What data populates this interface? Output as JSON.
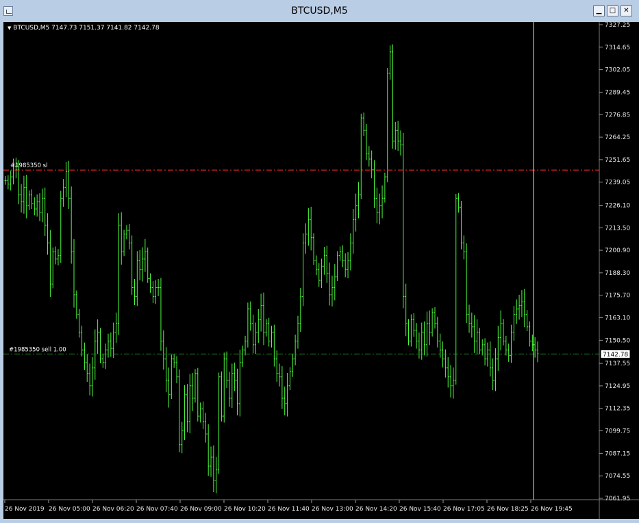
{
  "window": {
    "title": "BTCUSD,M5",
    "controls": [
      "minimize",
      "maximize",
      "close"
    ]
  },
  "chart": {
    "legend_symbol": "BTCUSD,M5",
    "legend_ohlc": "7147.73 7151.37 7141.82 7142.78",
    "current_price": "7142.78",
    "order_lines": [
      {
        "label": "#1985350 sl",
        "price": 7245.8,
        "color": "#ff2a2a"
      },
      {
        "label": "#1985350 sell 1.00",
        "price": 7142.78,
        "color": "#21a121"
      }
    ],
    "crosshair_time": "26 Nov 19:45"
  },
  "chart_data": {
    "type": "candlestick",
    "symbol": "BTCUSD",
    "timeframe": "M5",
    "ylim": [
      7055,
      7330
    ],
    "y_ticks": [
      "7327.25",
      "7314.65",
      "7302.05",
      "7289.45",
      "7276.85",
      "7264.25",
      "7251.65",
      "7239.05",
      "7226.10",
      "7213.50",
      "7200.90",
      "7188.30",
      "7175.70",
      "7163.10",
      "7150.50",
      "7137.55",
      "7124.95",
      "7112.35",
      "7099.75",
      "7087.15",
      "7074.55",
      "7061.95"
    ],
    "x_ticks": [
      "26 Nov 2019",
      "26 Nov 05:00",
      "26 Nov 06:20",
      "26 Nov 07:40",
      "26 Nov 09:00",
      "26 Nov 10:20",
      "26 Nov 11:40",
      "26 Nov 13:00",
      "26 Nov 14:20",
      "26 Nov 15:40",
      "26 Nov 17:05",
      "26 Nov 18:25",
      "26 Nov 19:45"
    ],
    "close_path": [
      7240,
      7238,
      7242,
      7248,
      7246,
      7232,
      7228,
      7236,
      7226,
      7232,
      7227,
      7224,
      7228,
      7222,
      7230,
      7215,
      7205,
      7182,
      7200,
      7196,
      7198,
      7230,
      7236,
      7245,
      7230,
      7200,
      7176,
      7165,
      7155,
      7145,
      7138,
      7132,
      7125,
      7135,
      7150,
      7155,
      7140,
      7138,
      7145,
      7150,
      7146,
      7155,
      7160,
      7215,
      7200,
      7210,
      7212,
      7205,
      7180,
      7175,
      7195,
      7190,
      7196,
      7200,
      7185,
      7180,
      7175,
      7180,
      7180,
      7150,
      7140,
      7128,
      7120,
      7140,
      7138,
      7130,
      7092,
      7100,
      7120,
      7105,
      7125,
      7118,
      7132,
      7108,
      7112,
      7105,
      7098,
      7080,
      7085,
      7072,
      7078,
      7130,
      7108,
      7140,
      7128,
      7118,
      7132,
      7128,
      7115,
      7138,
      7145,
      7150,
      7168,
      7160,
      7148,
      7155,
      7162,
      7170,
      7155,
      7160,
      7150,
      7155,
      7140,
      7132,
      7130,
      7118,
      7115,
      7125,
      7133,
      7140,
      7150,
      7160,
      7175,
      7205,
      7210,
      7218,
      7208,
      7195,
      7190,
      7184,
      7192,
      7198,
      7188,
      7176,
      7180,
      7186,
      7198,
      7200,
      7195,
      7190,
      7195,
      7205,
      7218,
      7226,
      7232,
      7275,
      7268,
      7255,
      7252,
      7246,
      7230,
      7222,
      7226,
      7230,
      7242,
      7300,
      7312,
      7262,
      7268,
      7262,
      7260,
      7175,
      7160,
      7150,
      7162,
      7156,
      7150,
      7145,
      7155,
      7148,
      7160,
      7155,
      7166,
      7160,
      7150,
      7145,
      7140,
      7135,
      7130,
      7125,
      7128,
      7230,
      7225,
      7205,
      7200,
      7165,
      7160,
      7158,
      7150,
      7155,
      7145,
      7148,
      7140,
      7145,
      7135,
      7128,
      7140,
      7152,
      7160,
      7150,
      7145,
      7142,
      7155,
      7165,
      7168,
      7170,
      7172,
      7165,
      7158,
      7150,
      7148,
      7145,
      7143
    ]
  }
}
